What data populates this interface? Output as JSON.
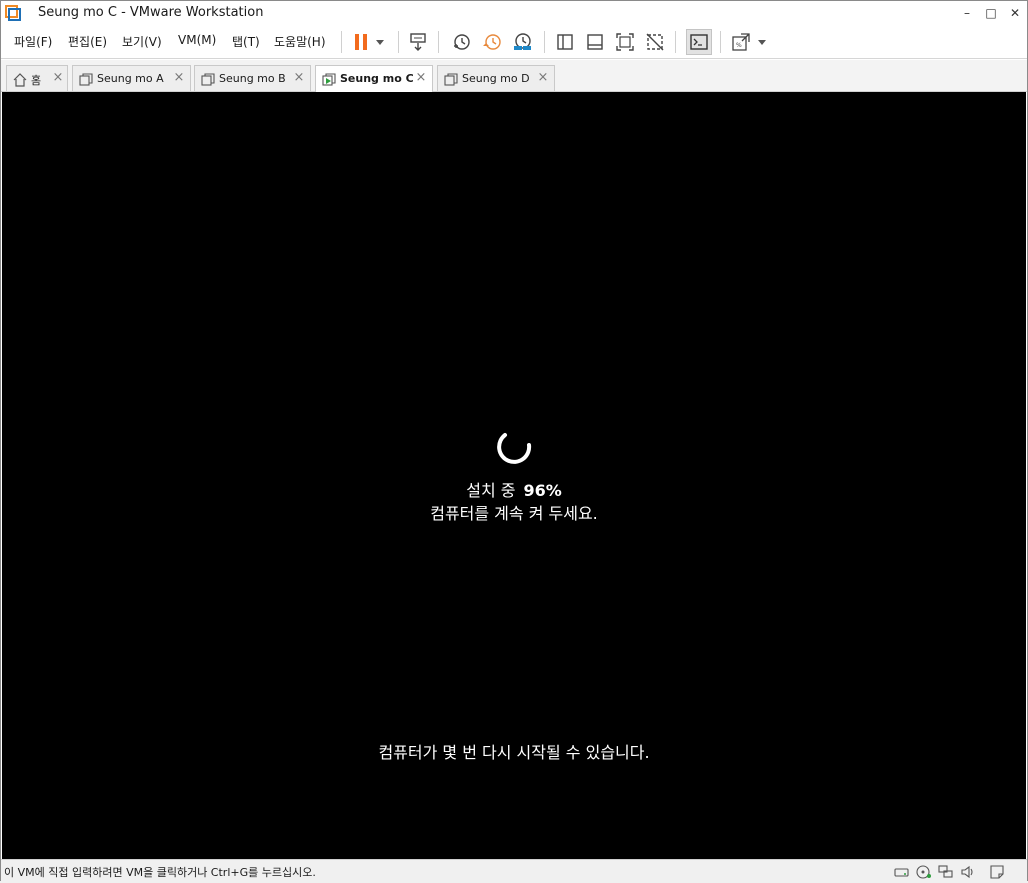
{
  "window": {
    "title": "Seung mo C - VMware Workstation",
    "controls": {
      "minimize": "–",
      "maximize": "□",
      "close": "✕"
    }
  },
  "menu": {
    "file": "파일(F)",
    "edit": "편집(E)",
    "view": "보기(V)",
    "vm": "VM(M)",
    "tabs": "탭(T)",
    "help": "도움말(H)"
  },
  "toolbar": {
    "icons": [
      "pause-icon",
      "dropdown-arrow-icon",
      "send-ctrl-alt-del-icon",
      "snapshot-take-icon",
      "snapshot-revert-icon",
      "snapshot-manager-icon",
      "show-library-icon",
      "show-thumbnail-icon",
      "full-screen-icon",
      "unity-icon",
      "console-view-icon",
      "stretch-guest-icon"
    ],
    "colors": {
      "pause": "#f26b1d",
      "snapshot_revert": "#e8893c",
      "snapshot_manager": "#1e88c8"
    }
  },
  "tabs": [
    {
      "label": "홈",
      "icon": "home-icon",
      "active": false
    },
    {
      "label": "Seung mo A",
      "icon": "vm-icon",
      "active": false
    },
    {
      "label": "Seung mo B",
      "icon": "vm-icon",
      "active": false
    },
    {
      "label": "Seung mo C",
      "icon": "vm-running-icon",
      "active": true
    },
    {
      "label": "Seung mo D",
      "icon": "vm-icon",
      "active": false
    }
  ],
  "vm_screen": {
    "installing_label": "설치 중",
    "progress_text": "96%",
    "progress": 0.96,
    "keep_on_text": "컴퓨터를 계속 켜 두세요.",
    "restart_note": "컴퓨터가 몇 번 다시 시작될 수 있습니다.",
    "background": "#000000"
  },
  "statusbar": {
    "hint": "이 VM에 직접 입력하려면 VM을 클릭하거나 Ctrl+G를 누르십시오.",
    "icons": [
      "hard-disk-icon",
      "cd-dvd-icon",
      "network-adapter-icon",
      "sound-icon",
      "message-log-icon"
    ]
  }
}
